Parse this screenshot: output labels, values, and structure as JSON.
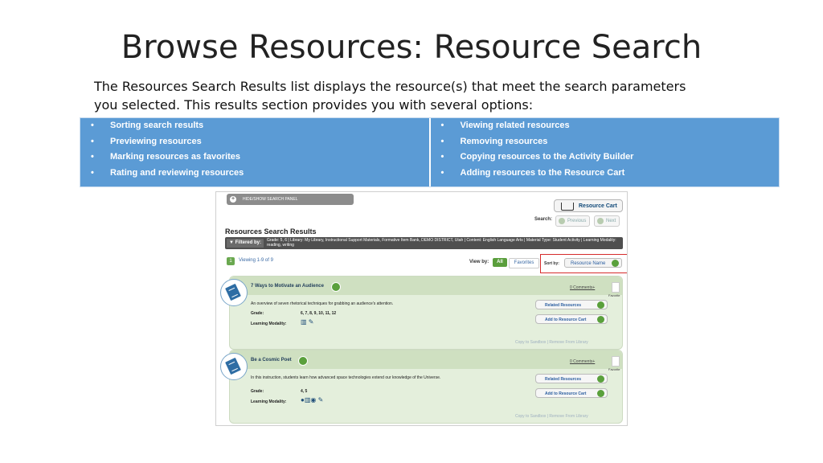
{
  "slide": {
    "title": "Browse Resources: Resource Search",
    "intro": "The Resources Search Results list displays the resource(s) that meet the search parameters you selected. This results section provides you with several options:"
  },
  "bullets": {
    "left": [
      "Sorting search results",
      "Previewing resources",
      "Marking resources as favorites",
      "Rating and reviewing resources"
    ],
    "right": [
      "Viewing related resources",
      "Removing resources",
      "Copying resources to the Activity Builder",
      "Adding resources to the Resource Cart"
    ]
  },
  "colors": {
    "bullet_bg": "#5b9bd5",
    "accent_green": "#5aa03c",
    "highlight": "#d62b2b"
  },
  "screenshot": {
    "hide_show": "HIDE/SHOW SEARCH PANEL",
    "resource_cart": "Resource Cart",
    "search_label": "Search:",
    "previous": "Previous",
    "next": "Next",
    "results_title": "Resources Search Results",
    "filtered_by_label": "Filtered by:",
    "filtered_by_value": "Grade: 5, 6 | Library: My Library, Instructional Support Materials, Formative Item Bank, DEMO DISTRICT, Utah | Content: English Language Arts | Material Type: Student Activity | Learning Modality: reading, writing",
    "page_number": "1",
    "viewing": "Viewing 1-9 of 9",
    "view_by": "View by:",
    "view_all": "All",
    "view_favorites": "Favorites",
    "sort_by": "Sort by:",
    "sort_value": "Resource Name",
    "items": [
      {
        "title": "7 Ways to Motivate an Audience",
        "comments": "0 Comments+",
        "favorite": "Favorite",
        "description": "An overview of seven rhetorical techniques for grabbing an audience's attention.",
        "grade_label": "Grade:",
        "grade": "6, 7, 8, 9, 10, 11, 12",
        "modality_label": "Learning Modality:",
        "related": "Related Resources",
        "add_cart": "Add to Resource Cart",
        "footer": "Copy to Sandbox | Remove From Library"
      },
      {
        "title": "Be a Cosmic Poet",
        "comments": "0 Comments+",
        "favorite": "Favorite",
        "description": "In this instruction, students learn how advanced space technologies extend our knowledge of the Universe.",
        "grade_label": "Grade:",
        "grade": "4, 5",
        "modality_label": "Learning Modality:",
        "related": "Related Resources",
        "add_cart": "Add to Resource Cart",
        "footer": "Copy to Sandbox | Remove From Library"
      }
    ]
  }
}
